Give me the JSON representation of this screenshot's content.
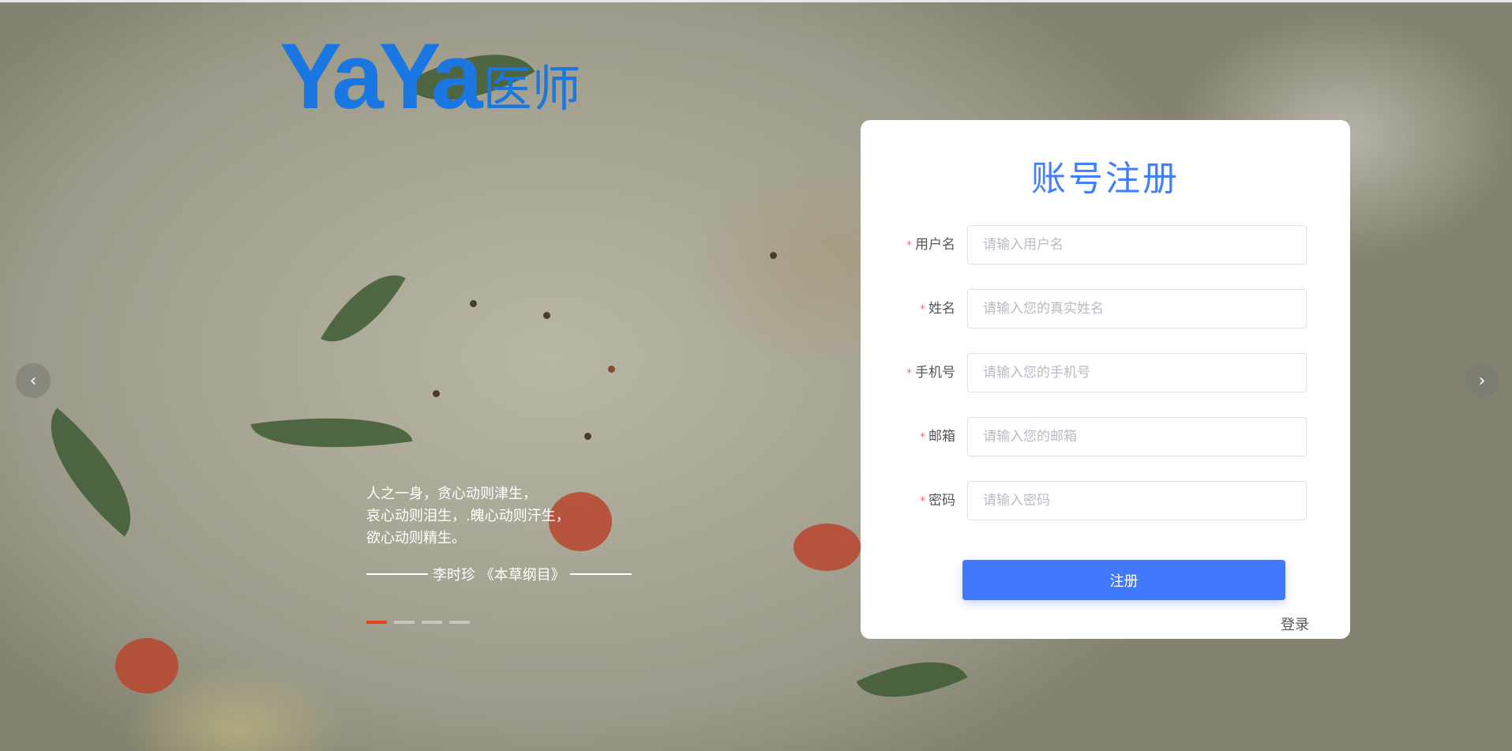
{
  "logo": {
    "en": "YaYa",
    "cn": "医师"
  },
  "carousel": {
    "quote_lines": [
      "人之一身，贪心动则津生，",
      "哀心动则泪生，.魄心动则汗生，",
      "欲心动则精生。"
    ],
    "attribution": "李时珍 《本草纲目》",
    "slide_count": 4,
    "active_slide": 1,
    "prev_icon": "‹",
    "next_icon": "›"
  },
  "form": {
    "title": "账号注册",
    "fields": [
      {
        "label": "用户名",
        "placeholder": "请输入用户名",
        "value": ""
      },
      {
        "label": "姓名",
        "placeholder": "请输入您的真实姓名",
        "value": ""
      },
      {
        "label": "手机号",
        "placeholder": "请输入您的手机号",
        "value": ""
      },
      {
        "label": "邮箱",
        "placeholder": "请输入您的邮箱",
        "value": ""
      },
      {
        "label": "密码",
        "placeholder": "请输入密码",
        "value": ""
      }
    ],
    "required_mark": "*",
    "submit_label": "注册",
    "login_link": "登录"
  },
  "colors": {
    "accent": "#4079fe",
    "logo": "#1a76e0",
    "required": "#f56c6c",
    "active_dot": "#e8441a"
  }
}
